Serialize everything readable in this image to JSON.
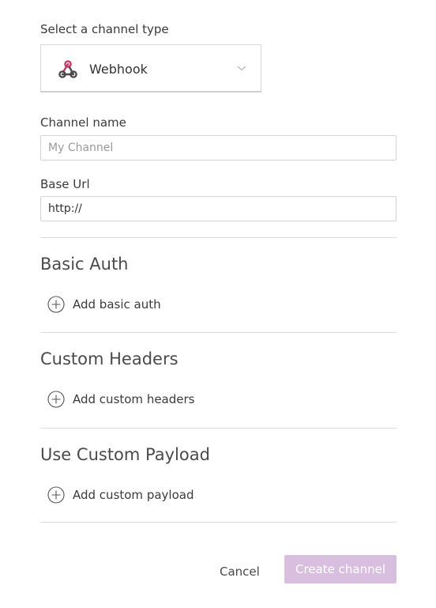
{
  "channel_type": {
    "label": "Select a channel type",
    "selected": "Webhook",
    "icon": "webhook-icon"
  },
  "channel_name": {
    "label": "Channel name",
    "value": "",
    "placeholder": "My Channel"
  },
  "base_url": {
    "label": "Base Url",
    "value": "http://",
    "placeholder": ""
  },
  "sections": [
    {
      "title": "Basic Auth",
      "add_label": "Add basic auth"
    },
    {
      "title": "Custom Headers",
      "add_label": "Add custom headers"
    },
    {
      "title": "Use Custom Payload",
      "add_label": "Add custom payload"
    }
  ],
  "actions": {
    "cancel_label": "Cancel",
    "create_label": "Create channel"
  },
  "colors": {
    "webhook_icon": "#c73a63",
    "webhook_icon_secondary": "#4b4b4b",
    "create_button_disabled": "#d8bfe0",
    "divider": "#dcdcdc"
  }
}
